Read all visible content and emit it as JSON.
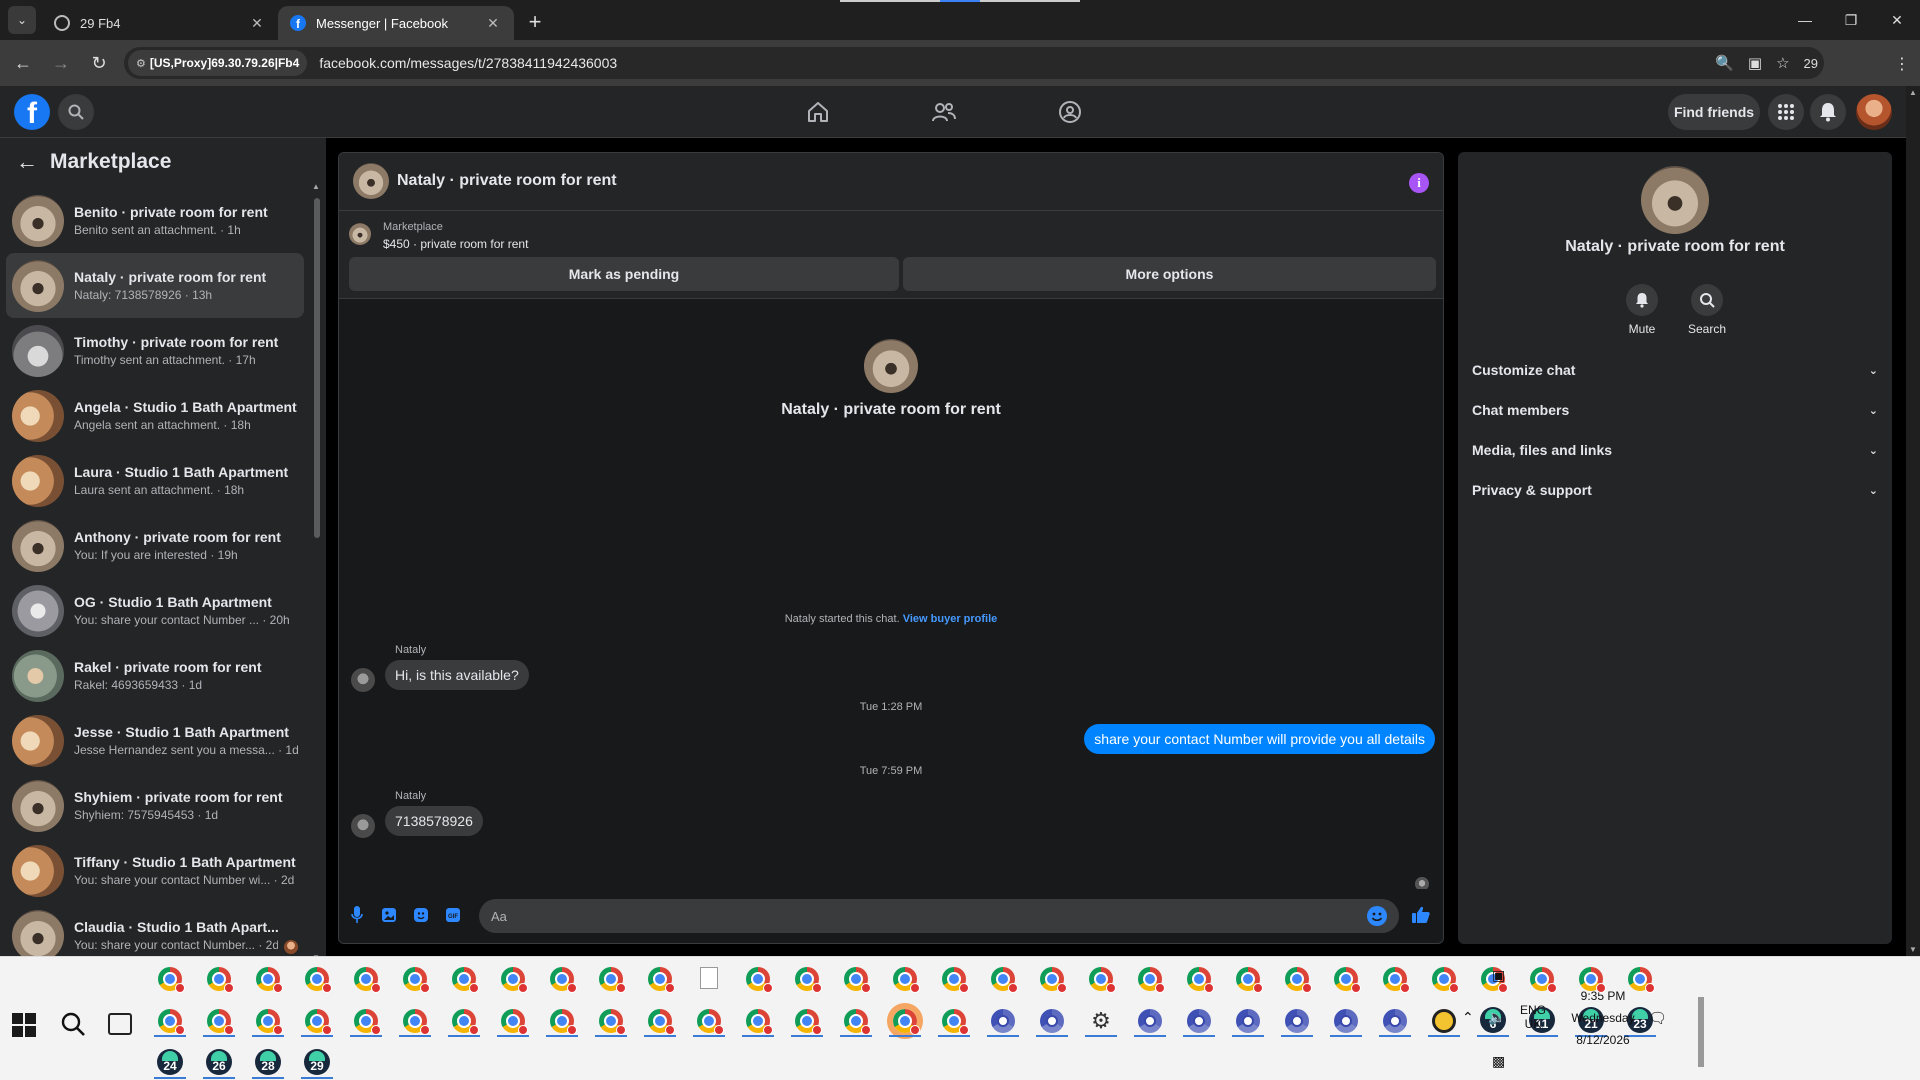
{
  "browser": {
    "tabs": [
      {
        "title": "29 Fb4",
        "active": false
      },
      {
        "title": "Messenger | Facebook",
        "active": true
      }
    ],
    "proxy_label": "[US,Proxy]69.30.79.26|Fb4",
    "url": "facebook.com/messages/t/27838411942436003",
    "profile_count": "29"
  },
  "header": {
    "find_friends_label": "Find friends"
  },
  "sidebar": {
    "title": "Marketplace",
    "conversations": [
      {
        "name": "Benito · private room for rent",
        "snippet": "Benito sent an attachment. · 1h"
      },
      {
        "name": "Nataly · private room for rent",
        "snippet": "Nataly: 7138578926 · 13h"
      },
      {
        "name": "Timothy · private room for rent",
        "snippet": "Timothy sent an attachment. · 17h"
      },
      {
        "name": "Angela · Studio 1 Bath Apartment",
        "snippet": "Angela sent an attachment. · 18h"
      },
      {
        "name": "Laura · Studio 1 Bath Apartment",
        "snippet": "Laura sent an attachment. · 18h"
      },
      {
        "name": "Anthony · private room for rent",
        "snippet": "You: If you are interested · 19h"
      },
      {
        "name": "OG · Studio 1 Bath Apartment",
        "snippet": "You: share your contact Number ... · 20h"
      },
      {
        "name": "Rakel · private room for rent",
        "snippet": "Rakel: 4693659433 · 1d"
      },
      {
        "name": "Jesse · Studio 1 Bath Apartment",
        "snippet": "Jesse Hernandez sent you a messa... · 1d"
      },
      {
        "name": "Shyhiem · private room for rent",
        "snippet": "Shyhiem: 7575945453 · 1d"
      },
      {
        "name": "Tiffany · Studio 1 Bath Apartment",
        "snippet": "You: share your contact Number wi... · 2d"
      },
      {
        "name": "Claudia · Studio 1 Bath Apart...",
        "snippet": "You: share your contact Number... · 2d"
      }
    ]
  },
  "chat": {
    "title": "Nataly · private room for rent",
    "listing_source": "Marketplace",
    "listing_price": "$450 · private room for rent",
    "mark_pending_label": "Mark as pending",
    "more_options_label": "More options",
    "center_name": "Nataly · private room for rent",
    "start_note": "Nataly started this chat.",
    "view_profile_link": "View buyer profile",
    "messages": [
      {
        "sender": "Nataly",
        "text": "Hi, is this available?"
      },
      {
        "timestamp": "Tue 1:28 PM"
      },
      {
        "sender": "You",
        "text": "share your contact Number will provide you all details"
      },
      {
        "timestamp": "Tue 7:59 PM"
      },
      {
        "sender": "Nataly",
        "text": "7138578926"
      }
    ],
    "composer_placeholder": "Aa"
  },
  "info_panel": {
    "name": "Nataly · private room for rent",
    "actions": [
      {
        "label": "Mute"
      },
      {
        "label": "Search"
      }
    ],
    "sections": [
      "Customize chat",
      "Chat members",
      "Media, files and links",
      "Privacy & support"
    ]
  },
  "taskbar": {
    "numbered_windows": [
      "6",
      "11",
      "21",
      "23",
      "24",
      "26",
      "28",
      "29"
    ],
    "language": "ENG",
    "region": "UK",
    "time": "9:35 PM",
    "day": "Wednesday",
    "date": "8/12/2026"
  },
  "colors": {
    "accent": "#0084ff",
    "fb_blue": "#1877f2",
    "info_purple": "#a855f7",
    "panel_bg": "#242526",
    "chat_bg": "#18191a"
  }
}
